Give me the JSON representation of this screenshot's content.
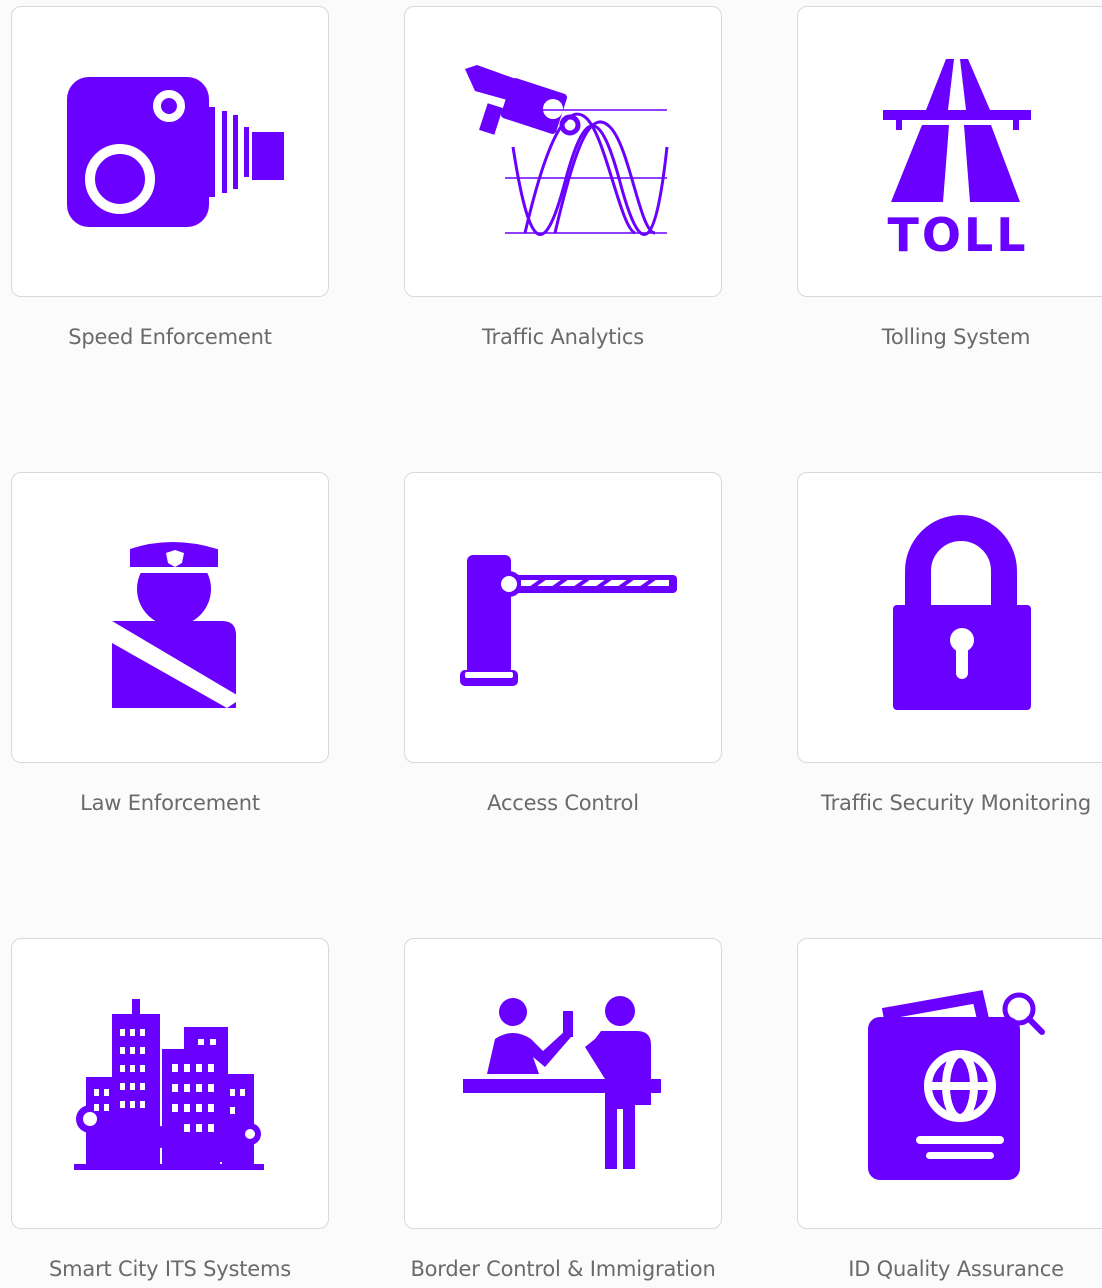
{
  "accent": "#6a00ff",
  "items": [
    {
      "label": "Speed Enforcement",
      "icon": "speed-camera-icon"
    },
    {
      "label": "Traffic Analytics",
      "icon": "traffic-camera-wave-icon"
    },
    {
      "label": "Tolling System",
      "icon": "toll-road-icon"
    },
    {
      "label": "Law Enforcement",
      "icon": "police-officer-icon"
    },
    {
      "label": "Access Control",
      "icon": "barrier-gate-icon"
    },
    {
      "label": "Traffic Security Monitoring",
      "icon": "padlock-icon"
    },
    {
      "label": "Smart City ITS Systems",
      "icon": "city-buildings-icon"
    },
    {
      "label": "Border Control & Immigration",
      "icon": "immigration-desk-icon"
    },
    {
      "label": "ID Quality Assurance",
      "icon": "passport-search-icon"
    }
  ],
  "toll_sign_text": "TOLL"
}
